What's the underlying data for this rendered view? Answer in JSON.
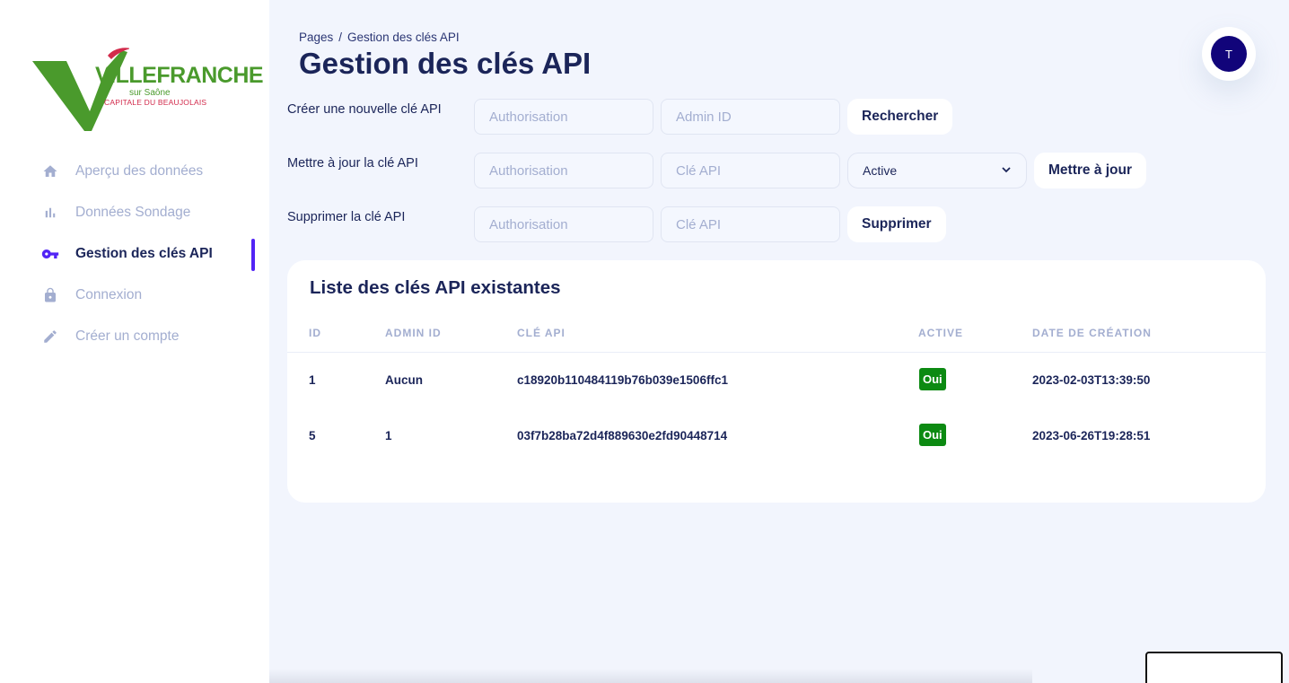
{
  "logo": {
    "title": "VILLEFRANCHE",
    "subtitle": "sur Saône",
    "tagline": "CAPITALE DU BEAUJOLAIS"
  },
  "sidebar": {
    "items": [
      {
        "label": "Aperçu des données",
        "icon": "home-icon",
        "active": false
      },
      {
        "label": "Données Sondage",
        "icon": "bar-chart-icon",
        "active": false
      },
      {
        "label": "Gestion des clés API",
        "icon": "key-icon",
        "active": true
      },
      {
        "label": "Connexion",
        "icon": "lock-icon",
        "active": false
      },
      {
        "label": "Créer un compte",
        "icon": "pencil-icon",
        "active": false
      }
    ]
  },
  "header": {
    "breadcrumb_root": "Pages",
    "breadcrumb_sep": "/",
    "breadcrumb_current": "Gestion des clés API",
    "title": "Gestion des clés API",
    "avatar_initial": "T"
  },
  "forms": {
    "create": {
      "label": "Créer une nouvelle clé API",
      "auth_placeholder": "Authorisation",
      "admin_placeholder": "Admin ID",
      "button": "Rechercher"
    },
    "update": {
      "label": "Mettre à jour la clé API",
      "auth_placeholder": "Authorisation",
      "key_placeholder": "Clé API",
      "status_value": "Active",
      "button": "Mettre à jour"
    },
    "delete": {
      "label": "Supprimer la clé API",
      "auth_placeholder": "Authorisation",
      "key_placeholder": "Clé API",
      "button": "Supprimer"
    }
  },
  "table": {
    "title": "Liste des clés API existantes",
    "headers": {
      "id": "ID",
      "admin_id": "ADMIN ID",
      "key": "CLÉ API",
      "active": "ACTIVE",
      "created": "DATE DE CRÉATION"
    },
    "rows": [
      {
        "id": "1",
        "admin_id": "Aucun",
        "key": "c18920b110484119b76b039e1506ffc1",
        "active": "Oui",
        "created": "2023-02-03T13:39:50"
      },
      {
        "id": "5",
        "admin_id": "1",
        "key": "03f7b28ba72d4f889630e2fd90448714",
        "active": "Oui",
        "created": "2023-06-26T19:28:51"
      }
    ]
  },
  "colors": {
    "brand_green": "#4a9a2c",
    "brand_red": "#d22a4b",
    "accent": "#5224f5",
    "badge_green": "#0c8a12",
    "text_dark": "#1b2559",
    "text_muted": "#a3aed0"
  }
}
